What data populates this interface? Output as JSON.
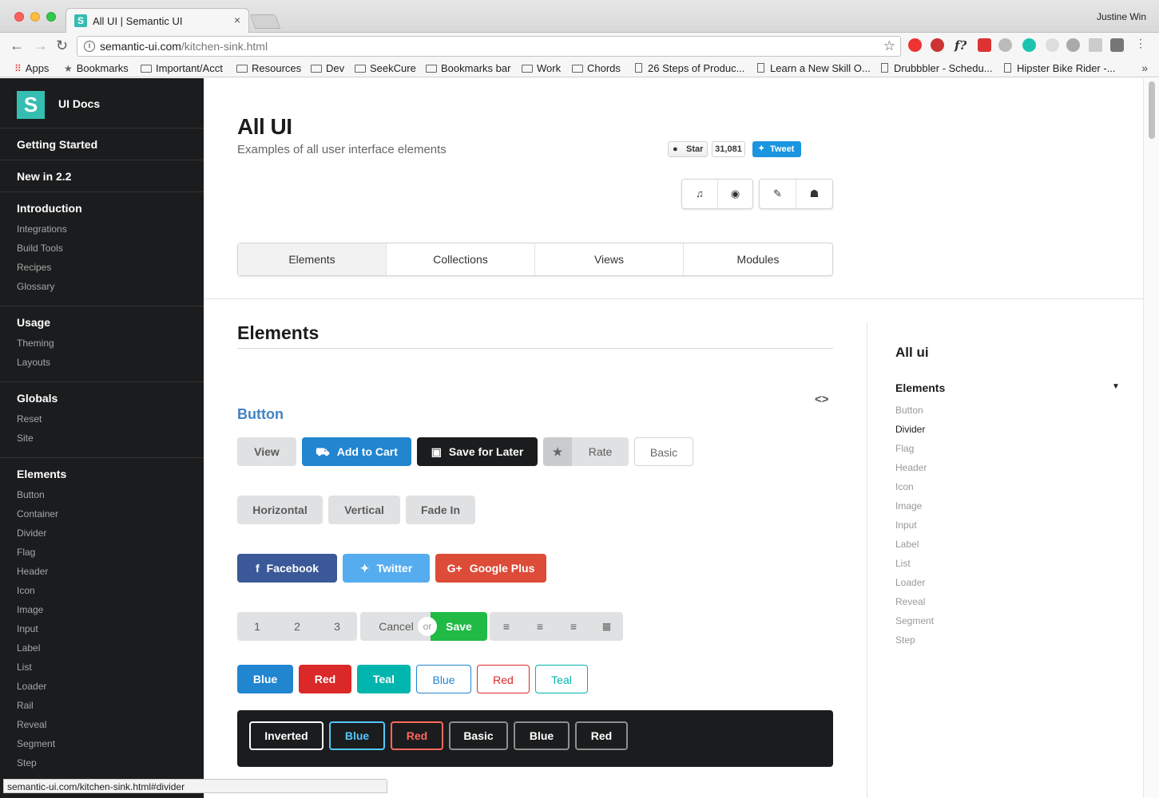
{
  "browser": {
    "tab_title": "All UI | Semantic UI",
    "tab_close": "×",
    "profile": "Justine Win",
    "url_host": "semantic-ui.com",
    "url_path": "/kitchen-sink.html",
    "bookmarks": [
      {
        "label": "Apps",
        "kind": "apps"
      },
      {
        "label": "Bookmarks",
        "kind": "star"
      },
      {
        "label": "Important/Acct",
        "kind": "folder"
      },
      {
        "label": "Resources",
        "kind": "folder"
      },
      {
        "label": "Dev",
        "kind": "folder"
      },
      {
        "label": "SeekCure",
        "kind": "folder"
      },
      {
        "label": "Bookmarks bar",
        "kind": "folder"
      },
      {
        "label": "Work",
        "kind": "folder"
      },
      {
        "label": "Chords",
        "kind": "folder"
      },
      {
        "label": "26 Steps of Produc...",
        "kind": "page"
      },
      {
        "label": "Learn a New Skill O...",
        "kind": "page"
      },
      {
        "label": "Drubbbler - Schedu...",
        "kind": "page"
      },
      {
        "label": "Hipster Bike Rider -...",
        "kind": "page"
      }
    ],
    "more_bookmarks": "»",
    "status_url": "semantic-ui.com/kitchen-sink.html#divider"
  },
  "sidebar": {
    "logo_letter": "S",
    "brand": "UI Docs",
    "getting_started": "Getting Started",
    "new_in": "New in 2.2",
    "introduction": {
      "title": "Introduction",
      "items": [
        "Integrations",
        "Build Tools",
        "Recipes",
        "Glossary"
      ]
    },
    "usage": {
      "title": "Usage",
      "items": [
        "Theming",
        "Layouts"
      ]
    },
    "globals": {
      "title": "Globals",
      "items": [
        "Reset",
        "Site"
      ]
    },
    "elements": {
      "title": "Elements",
      "items": [
        "Button",
        "Container",
        "Divider",
        "Flag",
        "Header",
        "Icon",
        "Image",
        "Input",
        "Label",
        "List",
        "Loader",
        "Rail",
        "Reveal",
        "Segment",
        "Step"
      ]
    }
  },
  "main": {
    "title": "All UI",
    "subtitle": "Examples of all user interface elements",
    "github_star": "Star",
    "github_count": "31,081",
    "tweet": "Tweet",
    "icon_buttons": [
      "music-icon",
      "globe-icon",
      "edit-icon",
      "github-icon"
    ],
    "tabs": [
      "Elements",
      "Collections",
      "Views",
      "Modules"
    ],
    "active_tab": "Elements",
    "section_title": "Elements",
    "code_toggle": "<>",
    "button_title": "Button",
    "row1": {
      "view": "View",
      "add_to_cart": "Add to Cart",
      "save_later": "Save for Later",
      "rate": "Rate",
      "basic": "Basic"
    },
    "row2": [
      "Horizontal",
      "Vertical",
      "Fade In"
    ],
    "row3": {
      "facebook": "Facebook",
      "twitter": "Twitter",
      "google": "Google Plus"
    },
    "row4": {
      "numbers": [
        "1",
        "2",
        "3"
      ],
      "cancel": "Cancel",
      "or": "or",
      "save": "Save"
    },
    "row5": [
      "Blue",
      "Red",
      "Teal",
      "Blue",
      "Red",
      "Teal"
    ],
    "inverted": [
      "Inverted",
      "Blue",
      "Red",
      "Basic",
      "Blue",
      "Red"
    ]
  },
  "rail": {
    "title": "All ui",
    "head": "Elements",
    "items": [
      "Button",
      "Divider",
      "Flag",
      "Header",
      "Icon",
      "Image",
      "Input",
      "Label",
      "List",
      "Loader",
      "Reveal",
      "Segment",
      "Step"
    ],
    "active_item": "Divider"
  },
  "colors": {
    "teal": "#35bdb2",
    "blue": "#2185d0",
    "red": "#db2828",
    "green": "#21ba45",
    "facebook": "#3b5998",
    "twitter": "#55acee",
    "google": "#dd4b39",
    "dark": "#1b1c1d"
  }
}
